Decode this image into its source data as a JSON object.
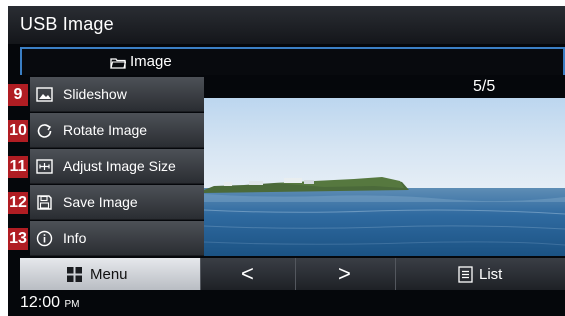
{
  "window": {
    "title": "USB Image"
  },
  "path": {
    "folder_icon": "folder-icon",
    "label": "Image"
  },
  "counter": "5/5",
  "side_menu": {
    "items": [
      {
        "number": "9",
        "icon": "slideshow-icon",
        "label": "Slideshow"
      },
      {
        "number": "10",
        "icon": "rotate-icon",
        "label": "Rotate Image"
      },
      {
        "number": "11",
        "icon": "resize-icon",
        "label": "Adjust Image Size"
      },
      {
        "number": "12",
        "icon": "save-icon",
        "label": "Save Image"
      },
      {
        "number": "13",
        "icon": "info-icon",
        "label": "Info"
      }
    ]
  },
  "bottom_bar": {
    "menu_label": "Menu",
    "prev_glyph": "<",
    "next_glyph": ">",
    "list_label": "List"
  },
  "status": {
    "time": "12:00",
    "ampm": "PM"
  },
  "colors": {
    "highlight_border": "#3b7fc4",
    "badge": "#b01d23"
  }
}
